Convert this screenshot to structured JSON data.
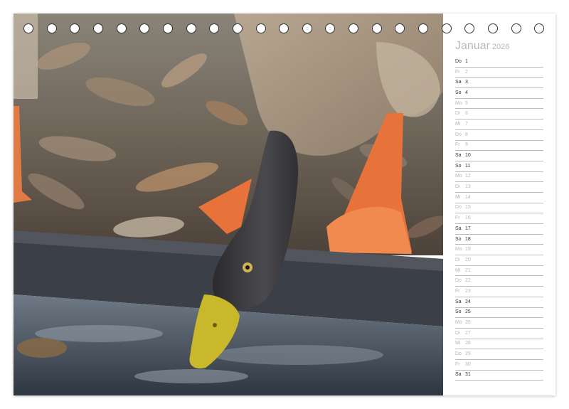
{
  "calendar": {
    "month": "Januar",
    "year": "2026",
    "days": [
      {
        "weekday": "Do",
        "day": "1",
        "weekend": true
      },
      {
        "weekday": "Fr",
        "day": "2",
        "weekend": false
      },
      {
        "weekday": "Sa",
        "day": "3",
        "weekend": true
      },
      {
        "weekday": "So",
        "day": "4",
        "weekend": true
      },
      {
        "weekday": "Mo",
        "day": "5",
        "weekend": false
      },
      {
        "weekday": "Di",
        "day": "6",
        "weekend": false
      },
      {
        "weekday": "Mi",
        "day": "7",
        "weekend": false
      },
      {
        "weekday": "Do",
        "day": "8",
        "weekend": false
      },
      {
        "weekday": "Fr",
        "day": "9",
        "weekend": false
      },
      {
        "weekday": "Sa",
        "day": "10",
        "weekend": true
      },
      {
        "weekday": "So",
        "day": "11",
        "weekend": true
      },
      {
        "weekday": "Mo",
        "day": "12",
        "weekend": false
      },
      {
        "weekday": "Di",
        "day": "13",
        "weekend": false
      },
      {
        "weekday": "Mi",
        "day": "14",
        "weekend": false
      },
      {
        "weekday": "Do",
        "day": "15",
        "weekend": false
      },
      {
        "weekday": "Fr",
        "day": "16",
        "weekend": false
      },
      {
        "weekday": "Sa",
        "day": "17",
        "weekend": true
      },
      {
        "weekday": "So",
        "day": "18",
        "weekend": true
      },
      {
        "weekday": "Mo",
        "day": "19",
        "weekend": false
      },
      {
        "weekday": "Di",
        "day": "20",
        "weekend": false
      },
      {
        "weekday": "Mi",
        "day": "21",
        "weekend": false
      },
      {
        "weekday": "Do",
        "day": "22",
        "weekend": false
      },
      {
        "weekday": "Fr",
        "day": "23",
        "weekend": false
      },
      {
        "weekday": "Sa",
        "day": "24",
        "weekend": true
      },
      {
        "weekday": "So",
        "day": "25",
        "weekend": true
      },
      {
        "weekday": "Mo",
        "day": "26",
        "weekend": false
      },
      {
        "weekday": "Di",
        "day": "27",
        "weekend": false
      },
      {
        "weekday": "Mi",
        "day": "28",
        "weekend": false
      },
      {
        "weekday": "Do",
        "day": "29",
        "weekend": false
      },
      {
        "weekday": "Fr",
        "day": "30",
        "weekend": false
      },
      {
        "weekday": "Sa",
        "day": "31",
        "weekend": true
      }
    ]
  },
  "binding": {
    "hole_count": 23
  },
  "colors": {
    "title": "#b9b9b9",
    "weekend_text": "#333333",
    "weekday_text": "#b8b8b8",
    "duck_feet": "#e8733a",
    "duck_bill": "#c9b82c"
  }
}
